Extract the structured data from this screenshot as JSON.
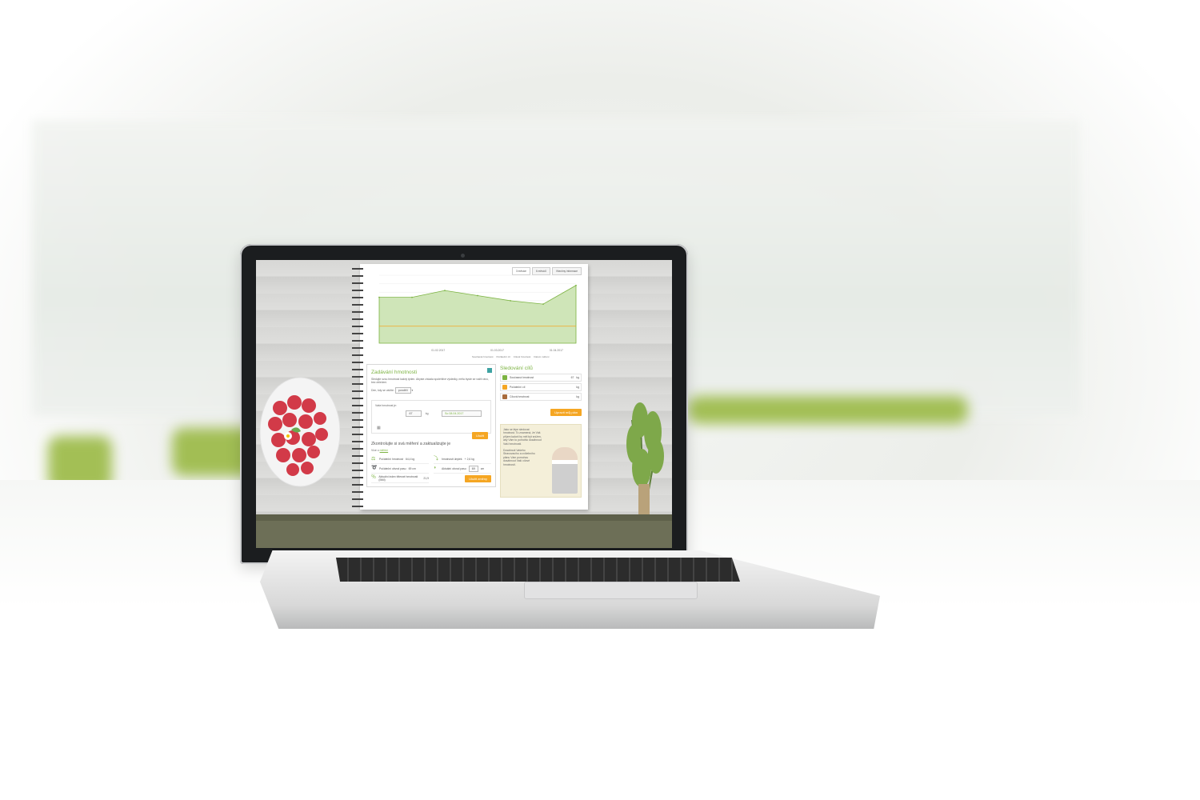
{
  "chart_data": {
    "type": "area",
    "x_ticks": [
      "01.02.2017",
      "01.03.2017",
      "01.04.2017"
    ],
    "series": [
      {
        "name": "Současná hmotnost",
        "values": [
          67.2,
          67.2,
          67.6,
          67.3,
          67.0,
          66.8,
          67.9
        ],
        "color": "#7cb342"
      },
      {
        "name": "Cílová hmotnost",
        "values": [
          65.5,
          65.5,
          65.5,
          65.5,
          65.5,
          65.5,
          65.5
        ],
        "color": "#f5a623"
      }
    ]
  },
  "chart": {
    "tabs": [
      "3 měsíce",
      "6 měsíců",
      "Všechny informace"
    ],
    "legend": [
      "Současná hmotnost",
      "Počáteční cíl",
      "Cílová hmotnost",
      "Datum měření"
    ]
  },
  "weight": {
    "title": "Zadávání hmotnosti",
    "intro": "Sledujte svou hmotnost každý týden. Abyste získala spolehlivé výsledky, měla byste se vážit ráno, bez oblečení.",
    "day_label": "Den, kdy se vážíte:",
    "day_value": "pondělí",
    "weight_label": "Vaše hmotnost je:",
    "weight_value": "67",
    "unit": "kg",
    "date_value": "So 08.04.2017",
    "save_label": "Uložit"
  },
  "measures": {
    "title": "Zkontrolujte si svá měření a zaktualizujte je",
    "more_prefix": "Více o",
    "more_link": "měření",
    "items": [
      {
        "label": "Počáteční hmotnost",
        "value": "64,4 kg",
        "icon": "scale-icon"
      },
      {
        "label": "hmotnosti úbytek",
        "value": "+ 2,6 kg",
        "icon": "trend-icon"
      },
      {
        "label": "Počáteční obvod pasu",
        "value": "69 cm",
        "icon": "tape-icon"
      },
      {
        "label": "Aktuální obvod pasu",
        "value": "",
        "input_value": "69",
        "unit": "cm",
        "icon": "waist-icon"
      },
      {
        "label": "Aktuální index tělesné hmotnosti (BMI)",
        "value": "21,9",
        "icon": "bmi-icon"
      }
    ],
    "save_label": "Uložit změny"
  },
  "goals": {
    "title": "Sledování cílů",
    "items": [
      {
        "label": "Současná hmotnost",
        "value": "67",
        "unit": "kg",
        "color": "#7cb342"
      },
      {
        "label": "Počáteční cíl",
        "value": "",
        "unit": "kg",
        "color": "#f5a623"
      },
      {
        "label": "Cílová hmotnost",
        "value": "",
        "unit": "kg",
        "color": "#a86b3c"
      }
    ],
    "button_label": "Upravit můj plán",
    "trainer_text_1": "Jako se lépe sledovat hmotnost. To znamená, že Váš příjem kalorií by měl být snížen, aby Vám to pomohlo dosáhnout Vaší hmotnosti.",
    "trainer_text_2": "Dosáhnutí Vašeho Stravovacího a cvičebního plánu Vám pomohou dosáhnout Vaší cílové hmotnosti."
  }
}
